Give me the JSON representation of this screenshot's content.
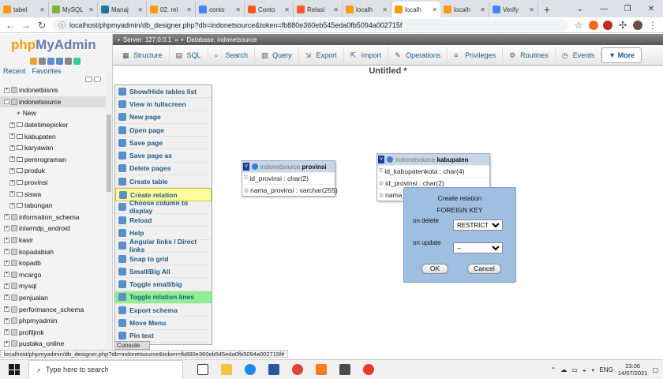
{
  "browser": {
    "tabs": [
      {
        "label": "tabel",
        "color": "#f89c0e"
      },
      {
        "label": "MySQL",
        "color": "#7cb342"
      },
      {
        "label": "Manaj",
        "color": "#21759b"
      },
      {
        "label": "02. rel",
        "color": "#f89c0e"
      },
      {
        "label": "conto",
        "color": "#4285f4"
      },
      {
        "label": "Conto",
        "color": "#ff5722"
      },
      {
        "label": "Relasi",
        "color": "#ff5722"
      },
      {
        "label": "localh",
        "color": "#f89c0e"
      },
      {
        "label": "localh",
        "color": "#f89c0e",
        "active": true
      },
      {
        "label": "localh",
        "color": "#f89c0e"
      },
      {
        "label": "Verify",
        "color": "#4285f4"
      }
    ],
    "new_tab": "+",
    "url": "localhost/phpmyadmin/db_designer.php?db=indonetsource&token=fb880e360eb545eda0fb5094a002715f"
  },
  "pma": {
    "logo_php": "php",
    "logo_my": "MyAdmin",
    "recent": "Recent",
    "favorites": "Favorites",
    "databases": [
      {
        "name": "indonetbisnis",
        "type": "db",
        "sign": "+"
      },
      {
        "name": "indonetsource",
        "type": "db",
        "sign": "−",
        "selected": true
      },
      {
        "name": "New",
        "type": "new"
      },
      {
        "name": "datetimepicker",
        "type": "table"
      },
      {
        "name": "kabupaten",
        "type": "table"
      },
      {
        "name": "karyawan",
        "type": "table"
      },
      {
        "name": "pemrograman",
        "type": "table"
      },
      {
        "name": "produk",
        "type": "table"
      },
      {
        "name": "provinsi",
        "type": "table"
      },
      {
        "name": "siswa",
        "type": "table"
      },
      {
        "name": "tabungan",
        "type": "table"
      },
      {
        "name": "information_schema",
        "type": "db",
        "sign": "+"
      },
      {
        "name": "iniwrndp_android",
        "type": "db",
        "sign": "+"
      },
      {
        "name": "kasir",
        "type": "db",
        "sign": "+"
      },
      {
        "name": "kopadabiah",
        "type": "db",
        "sign": "+"
      },
      {
        "name": "kopadb",
        "type": "db",
        "sign": "+"
      },
      {
        "name": "mcargo",
        "type": "db",
        "sign": "+"
      },
      {
        "name": "mysql",
        "type": "db",
        "sign": "+"
      },
      {
        "name": "penjualan",
        "type": "db",
        "sign": "+"
      },
      {
        "name": "performance_schema",
        "type": "db",
        "sign": "+"
      },
      {
        "name": "phpmyadmin",
        "type": "db",
        "sign": "+"
      },
      {
        "name": "profiljmk",
        "type": "db",
        "sign": "+"
      },
      {
        "name": "pustaka_online",
        "type": "db",
        "sign": "+"
      }
    ],
    "breadcrumb": {
      "server": "Server: 127.0.0.1",
      "sep": "»",
      "database": "Database: indonetsource"
    },
    "menu": [
      {
        "label": "Structure",
        "icon": "▦"
      },
      {
        "label": "SQL",
        "icon": "▤"
      },
      {
        "label": "Search",
        "icon": "⌕"
      },
      {
        "label": "Query",
        "icon": "▥"
      },
      {
        "label": "Export",
        "icon": "⇲"
      },
      {
        "label": "Import",
        "icon": "⇱"
      },
      {
        "label": "Operations",
        "icon": "✎"
      },
      {
        "label": "Privileges",
        "icon": "≡"
      },
      {
        "label": "Routines",
        "icon": "⚙"
      },
      {
        "label": "Events",
        "icon": "◷"
      }
    ],
    "more": "▼ More",
    "designer_title": "Untitled *",
    "side_menu": [
      {
        "label": "Show/Hide tables list"
      },
      {
        "label": "View in fullscreen"
      },
      {
        "label": "New page"
      },
      {
        "label": "Open page"
      },
      {
        "label": "Save page"
      },
      {
        "label": "Save page as"
      },
      {
        "label": "Delete pages"
      },
      {
        "label": "Create table"
      },
      {
        "label": "Create relation",
        "state": "highlight"
      },
      {
        "label": "Choose column to display"
      },
      {
        "label": "Reload"
      },
      {
        "label": "Help"
      },
      {
        "label": "Angular links / Direct links"
      },
      {
        "label": "Snap to grid"
      },
      {
        "label": "Small/Big All"
      },
      {
        "label": "Toggle small/big"
      },
      {
        "label": "Toggle relation lines",
        "state": "active"
      },
      {
        "label": "Export schema"
      },
      {
        "label": "Move Menu"
      },
      {
        "label": "Pin text"
      }
    ],
    "console": "Console",
    "tables": {
      "provinsi": {
        "db": "indonetsource.",
        "name": "provinsi",
        "columns": [
          "id_provinsi : char(2)",
          "nama_provinsi : varchar(255)"
        ]
      },
      "kabupaten": {
        "db": "indonetsource.",
        "name": "kabupaten",
        "columns": [
          "id_kabupatenkota : char(4)",
          "id_provinsi : char(2)",
          "nama_"
        ]
      }
    },
    "dialog": {
      "title": "Create relation",
      "subtitle": "FOREIGN KEY",
      "on_delete_label": "on delete",
      "on_delete_value": "RESTRICT",
      "on_update_label": "on update",
      "on_update_value": "--",
      "ok": "OK",
      "cancel": "Cancel"
    }
  },
  "status_url": "localhost/phpmyadmin/db_designer.php?db=indonetsource&token=fb880e360eb545eda0fb5094a002715f#",
  "taskbar": {
    "search_placeholder": "Type here to search",
    "language": "ENG",
    "time": "23:06",
    "date": "14/07/2021"
  }
}
